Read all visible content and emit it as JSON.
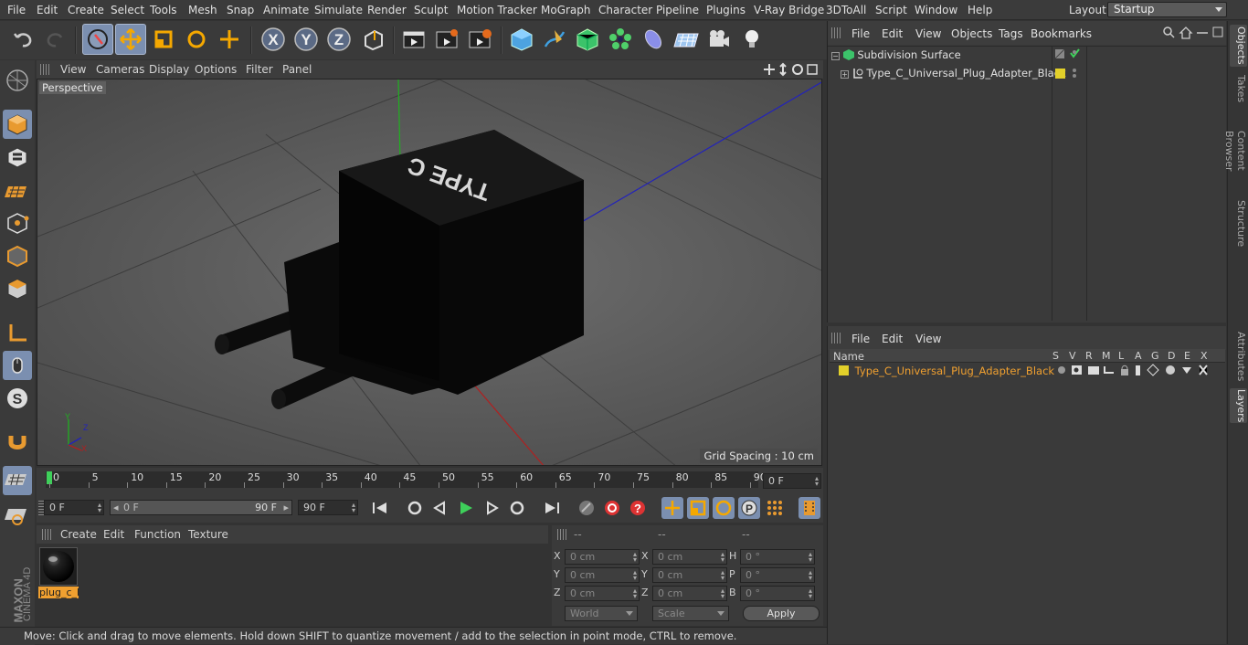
{
  "menubar": {
    "items": [
      "File",
      "Edit",
      "Create",
      "Select",
      "Tools",
      "Mesh",
      "Snap",
      "Animate",
      "Simulate",
      "Render",
      "Sculpt",
      "Motion Tracker",
      "MoGraph",
      "Character",
      "Pipeline",
      "Plugins",
      "V-Ray Bridge",
      "3DToAll",
      "Script",
      "Window",
      "Help"
    ],
    "layout_label": "Layout:",
    "layout_value": "Startup"
  },
  "toolbar": {
    "icons": [
      "undo-icon",
      "redo-icon",
      "live-selection-icon",
      "move-icon",
      "scale-icon",
      "rotate-icon",
      "add-icon",
      "x-axis-icon",
      "y-axis-icon",
      "z-axis-icon",
      "coordinate-system-icon",
      "render-view-icon",
      "render-picture-viewer-icon",
      "render-settings-icon",
      "cube-icon",
      "pen-icon",
      "subdivision-icon",
      "cloner-icon",
      "deformer-icon",
      "floor-icon",
      "camera-icon",
      "light-icon"
    ],
    "axis_labels": [
      "X",
      "Y",
      "Z"
    ]
  },
  "viewport": {
    "menu": [
      "View",
      "Cameras",
      "Display",
      "Options",
      "Filter",
      "Panel"
    ],
    "label": "Perspective",
    "grid_spacing": "Grid Spacing : 10 cm",
    "model_text": "TYPE C"
  },
  "timeline": {
    "ticks": [
      "0",
      "5",
      "10",
      "15",
      "20",
      "25",
      "30",
      "35",
      "40",
      "45",
      "50",
      "55",
      "60",
      "65",
      "70",
      "75",
      "80",
      "85",
      "90"
    ],
    "current_frame": "0 F"
  },
  "anim": {
    "start": "0 F",
    "range_start": "0 F",
    "range_end": "90 F",
    "end": "90 F"
  },
  "material_manager": {
    "menu": [
      "Create",
      "Edit",
      "Function",
      "Texture"
    ],
    "material_name": "plug_c_l"
  },
  "coordinates": {
    "header": [
      "--",
      "--",
      "--"
    ],
    "rows": [
      {
        "a": "X",
        "av": "0 cm",
        "b": "X",
        "bv": "0 cm",
        "c": "H",
        "cv": "0 °"
      },
      {
        "a": "Y",
        "av": "0 cm",
        "b": "Y",
        "bv": "0 cm",
        "c": "P",
        "cv": "0 °"
      },
      {
        "a": "Z",
        "av": "0 cm",
        "b": "Z",
        "bv": "0 cm",
        "c": "B",
        "cv": "0 °"
      }
    ],
    "world": "World",
    "scale": "Scale",
    "apply": "Apply"
  },
  "status": "Move: Click and drag to move elements. Hold down SHIFT to quantize movement / add to the selection in point mode, CTRL to remove.",
  "object_manager": {
    "menu": [
      "File",
      "Edit",
      "View",
      "Objects",
      "Tags",
      "Bookmarks"
    ],
    "objects": [
      "Subdivision Surface",
      "Type_C_Universal_Plug_Adapter_Black"
    ]
  },
  "layer_manager": {
    "menu": [
      "File",
      "Edit",
      "View"
    ],
    "columns": [
      "Name",
      "S",
      "V",
      "R",
      "M",
      "L",
      "A",
      "G",
      "D",
      "E",
      "X"
    ],
    "layer_name": "Type_C_Universal_Plug_Adapter_Black"
  },
  "right_tabs": [
    "Objects",
    "Takes",
    "Content Browser",
    "Structure",
    "Attributes",
    "Layers"
  ],
  "brand": {
    "maxon": "MAXON",
    "cinema": "CINEMA 4D"
  },
  "colors": {
    "accent": "#7b8fb0",
    "layer": "#e2d02a",
    "material_label": "#f0a030"
  }
}
